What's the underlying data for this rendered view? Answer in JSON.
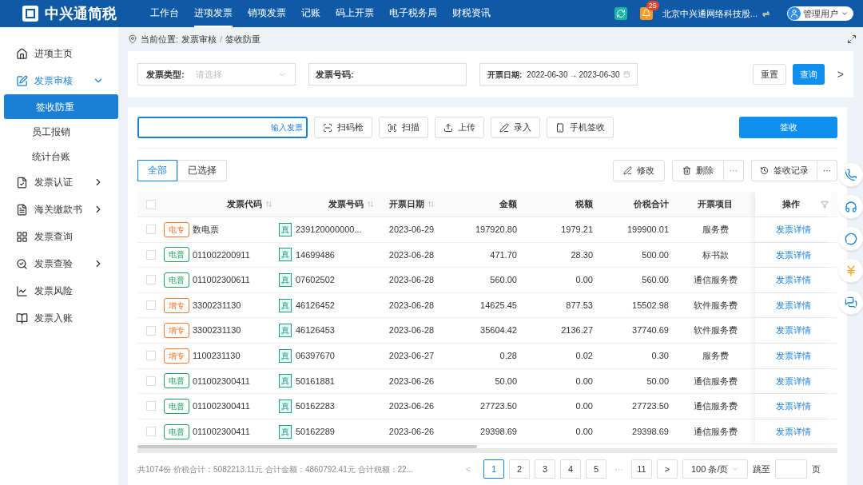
{
  "header": {
    "logo_text": "中兴通简税",
    "nav": [
      {
        "label": "工作台",
        "selected": false
      },
      {
        "label": "进项发票",
        "selected": true
      },
      {
        "label": "销项发票",
        "selected": false
      },
      {
        "label": "记账",
        "selected": false
      },
      {
        "label": "码上开票",
        "selected": false
      },
      {
        "label": "电子税务局",
        "selected": false
      },
      {
        "label": "财税资讯",
        "selected": false
      }
    ],
    "notification_count": "25",
    "company": "北京中兴通网络科技股...",
    "swap": "⇌",
    "user": "管理用户"
  },
  "sidebar": {
    "items": [
      {
        "label": "进项主页",
        "expanded": false,
        "has_children": false
      },
      {
        "label": "发票审核",
        "expanded": true,
        "has_children": true,
        "children": [
          {
            "label": "签收防重",
            "selected": true
          },
          {
            "label": "员工报销",
            "selected": false
          },
          {
            "label": "统计台账",
            "selected": false
          }
        ]
      },
      {
        "label": "发票认证",
        "expanded": false,
        "has_children": true
      },
      {
        "label": "海关缴款书",
        "expanded": false,
        "has_children": true
      },
      {
        "label": "发票查询",
        "expanded": false,
        "has_children": false
      },
      {
        "label": "发票查验",
        "expanded": false,
        "has_children": true
      },
      {
        "label": "发票风险",
        "expanded": false,
        "has_children": false
      },
      {
        "label": "发票入账",
        "expanded": false,
        "has_children": false
      }
    ]
  },
  "breadcrumb": {
    "label": "当前位置:",
    "path": "发票审核",
    "sep": "/",
    "current": "签收防重"
  },
  "filters": {
    "type_label": "发票类型:",
    "type_placeholder": "请选择",
    "number_label": "发票号码:",
    "date_label": "开票日期:",
    "date_start": "2022-06-30",
    "date_sep": "→",
    "date_end": "2023-06-30",
    "reset": "重置",
    "query": "查询",
    "more": ">"
  },
  "toolbar": {
    "input_placeholder": "输入发票",
    "buttons": [
      {
        "label": "扫码枪"
      },
      {
        "label": "扫描"
      },
      {
        "label": "上传"
      },
      {
        "label": "录入"
      },
      {
        "label": "手机签收"
      }
    ],
    "sign": "签收"
  },
  "view_tabs": [
    {
      "label": "全部",
      "selected": true
    },
    {
      "label": "已选择",
      "selected": false
    }
  ],
  "actions": {
    "edit": "修改",
    "delete": "删除",
    "more1": "···",
    "history": "签收记录",
    "more2": "···"
  },
  "table": {
    "all_checked": false,
    "columns": [
      "发票代码",
      "发票号码",
      "开票日期",
      "金额",
      "税额",
      "价税合计",
      "开票项目",
      "操作"
    ],
    "rows": [
      {
        "checked": false,
        "tag": "电专",
        "color": "#f0772f",
        "code": "数电票",
        "num_tag": "真",
        "number": "239120000000...",
        "date": "2023-06-29",
        "amount": "197920.80",
        "tax": "1979.21",
        "total": "199900.01",
        "item": "服务费",
        "action": "发票详情"
      },
      {
        "checked": false,
        "tag": "电普",
        "color": "#1aa35d",
        "code": "011002200911",
        "num_tag": "真",
        "number": "14699486",
        "date": "2023-06-28",
        "amount": "471.70",
        "tax": "28.30",
        "total": "500.00",
        "item": "标书款",
        "action": "发票详情"
      },
      {
        "checked": false,
        "tag": "电普",
        "color": "#1aa35d",
        "code": "011002300611",
        "num_tag": "真",
        "number": "07602502",
        "date": "2023-06-28",
        "amount": "560.00",
        "tax": "0.00",
        "total": "560.00",
        "item": "通信服务费",
        "action": "发票详情"
      },
      {
        "checked": false,
        "tag": "增专",
        "color": "#f0772f",
        "code": "3300231130",
        "num_tag": "真",
        "number": "46126452",
        "date": "2023-06-28",
        "amount": "14625.45",
        "tax": "877.53",
        "total": "15502.98",
        "item": "软件服务费",
        "action": "发票详情"
      },
      {
        "checked": false,
        "tag": "增专",
        "color": "#f0772f",
        "code": "3300231130",
        "num_tag": "真",
        "number": "46126453",
        "date": "2023-06-28",
        "amount": "35604.42",
        "tax": "2136.27",
        "total": "37740.69",
        "item": "软件服务费",
        "action": "发票详情"
      },
      {
        "checked": false,
        "tag": "增专",
        "color": "#f0772f",
        "code": "1100231130",
        "num_tag": "真",
        "number": "06397670",
        "date": "2023-06-27",
        "amount": "0.28",
        "tax": "0.02",
        "total": "0.30",
        "item": "服务费",
        "action": "发票详情"
      },
      {
        "checked": false,
        "tag": "电普",
        "color": "#1aa35d",
        "code": "011002300411",
        "num_tag": "真",
        "number": "50161881",
        "date": "2023-06-26",
        "amount": "50.00",
        "tax": "0.00",
        "total": "50.00",
        "item": "通信服务费",
        "action": "发票详情"
      },
      {
        "checked": false,
        "tag": "电普",
        "color": "#1aa35d",
        "code": "011002300411",
        "num_tag": "真",
        "number": "50162283",
        "date": "2023-06-26",
        "amount": "27723.50",
        "tax": "0.00",
        "total": "27723.50",
        "item": "通信服务费",
        "action": "发票详情"
      },
      {
        "checked": false,
        "tag": "电普",
        "color": "#1aa35d",
        "code": "011002300411",
        "num_tag": "真",
        "number": "50162289",
        "date": "2023-06-26",
        "amount": "29398.69",
        "tax": "0.00",
        "total": "29398.69",
        "item": "通信服务费",
        "action": "发票详情"
      }
    ]
  },
  "footer": {
    "summary": "共1074份 价税合计：5082213.11元 合计金额：4860792.41元 合计税额：22...",
    "prev": "<",
    "pages": [
      {
        "label": "1",
        "selected": true
      },
      {
        "label": "2",
        "selected": false
      },
      {
        "label": "3",
        "selected": false
      },
      {
        "label": "4",
        "selected": false
      },
      {
        "label": "5",
        "selected": false
      }
    ],
    "ellipsis": "···",
    "last": "11",
    "next": ">",
    "page_size": "100 条/页",
    "jump": "跳至",
    "page_unit": "页"
  }
}
